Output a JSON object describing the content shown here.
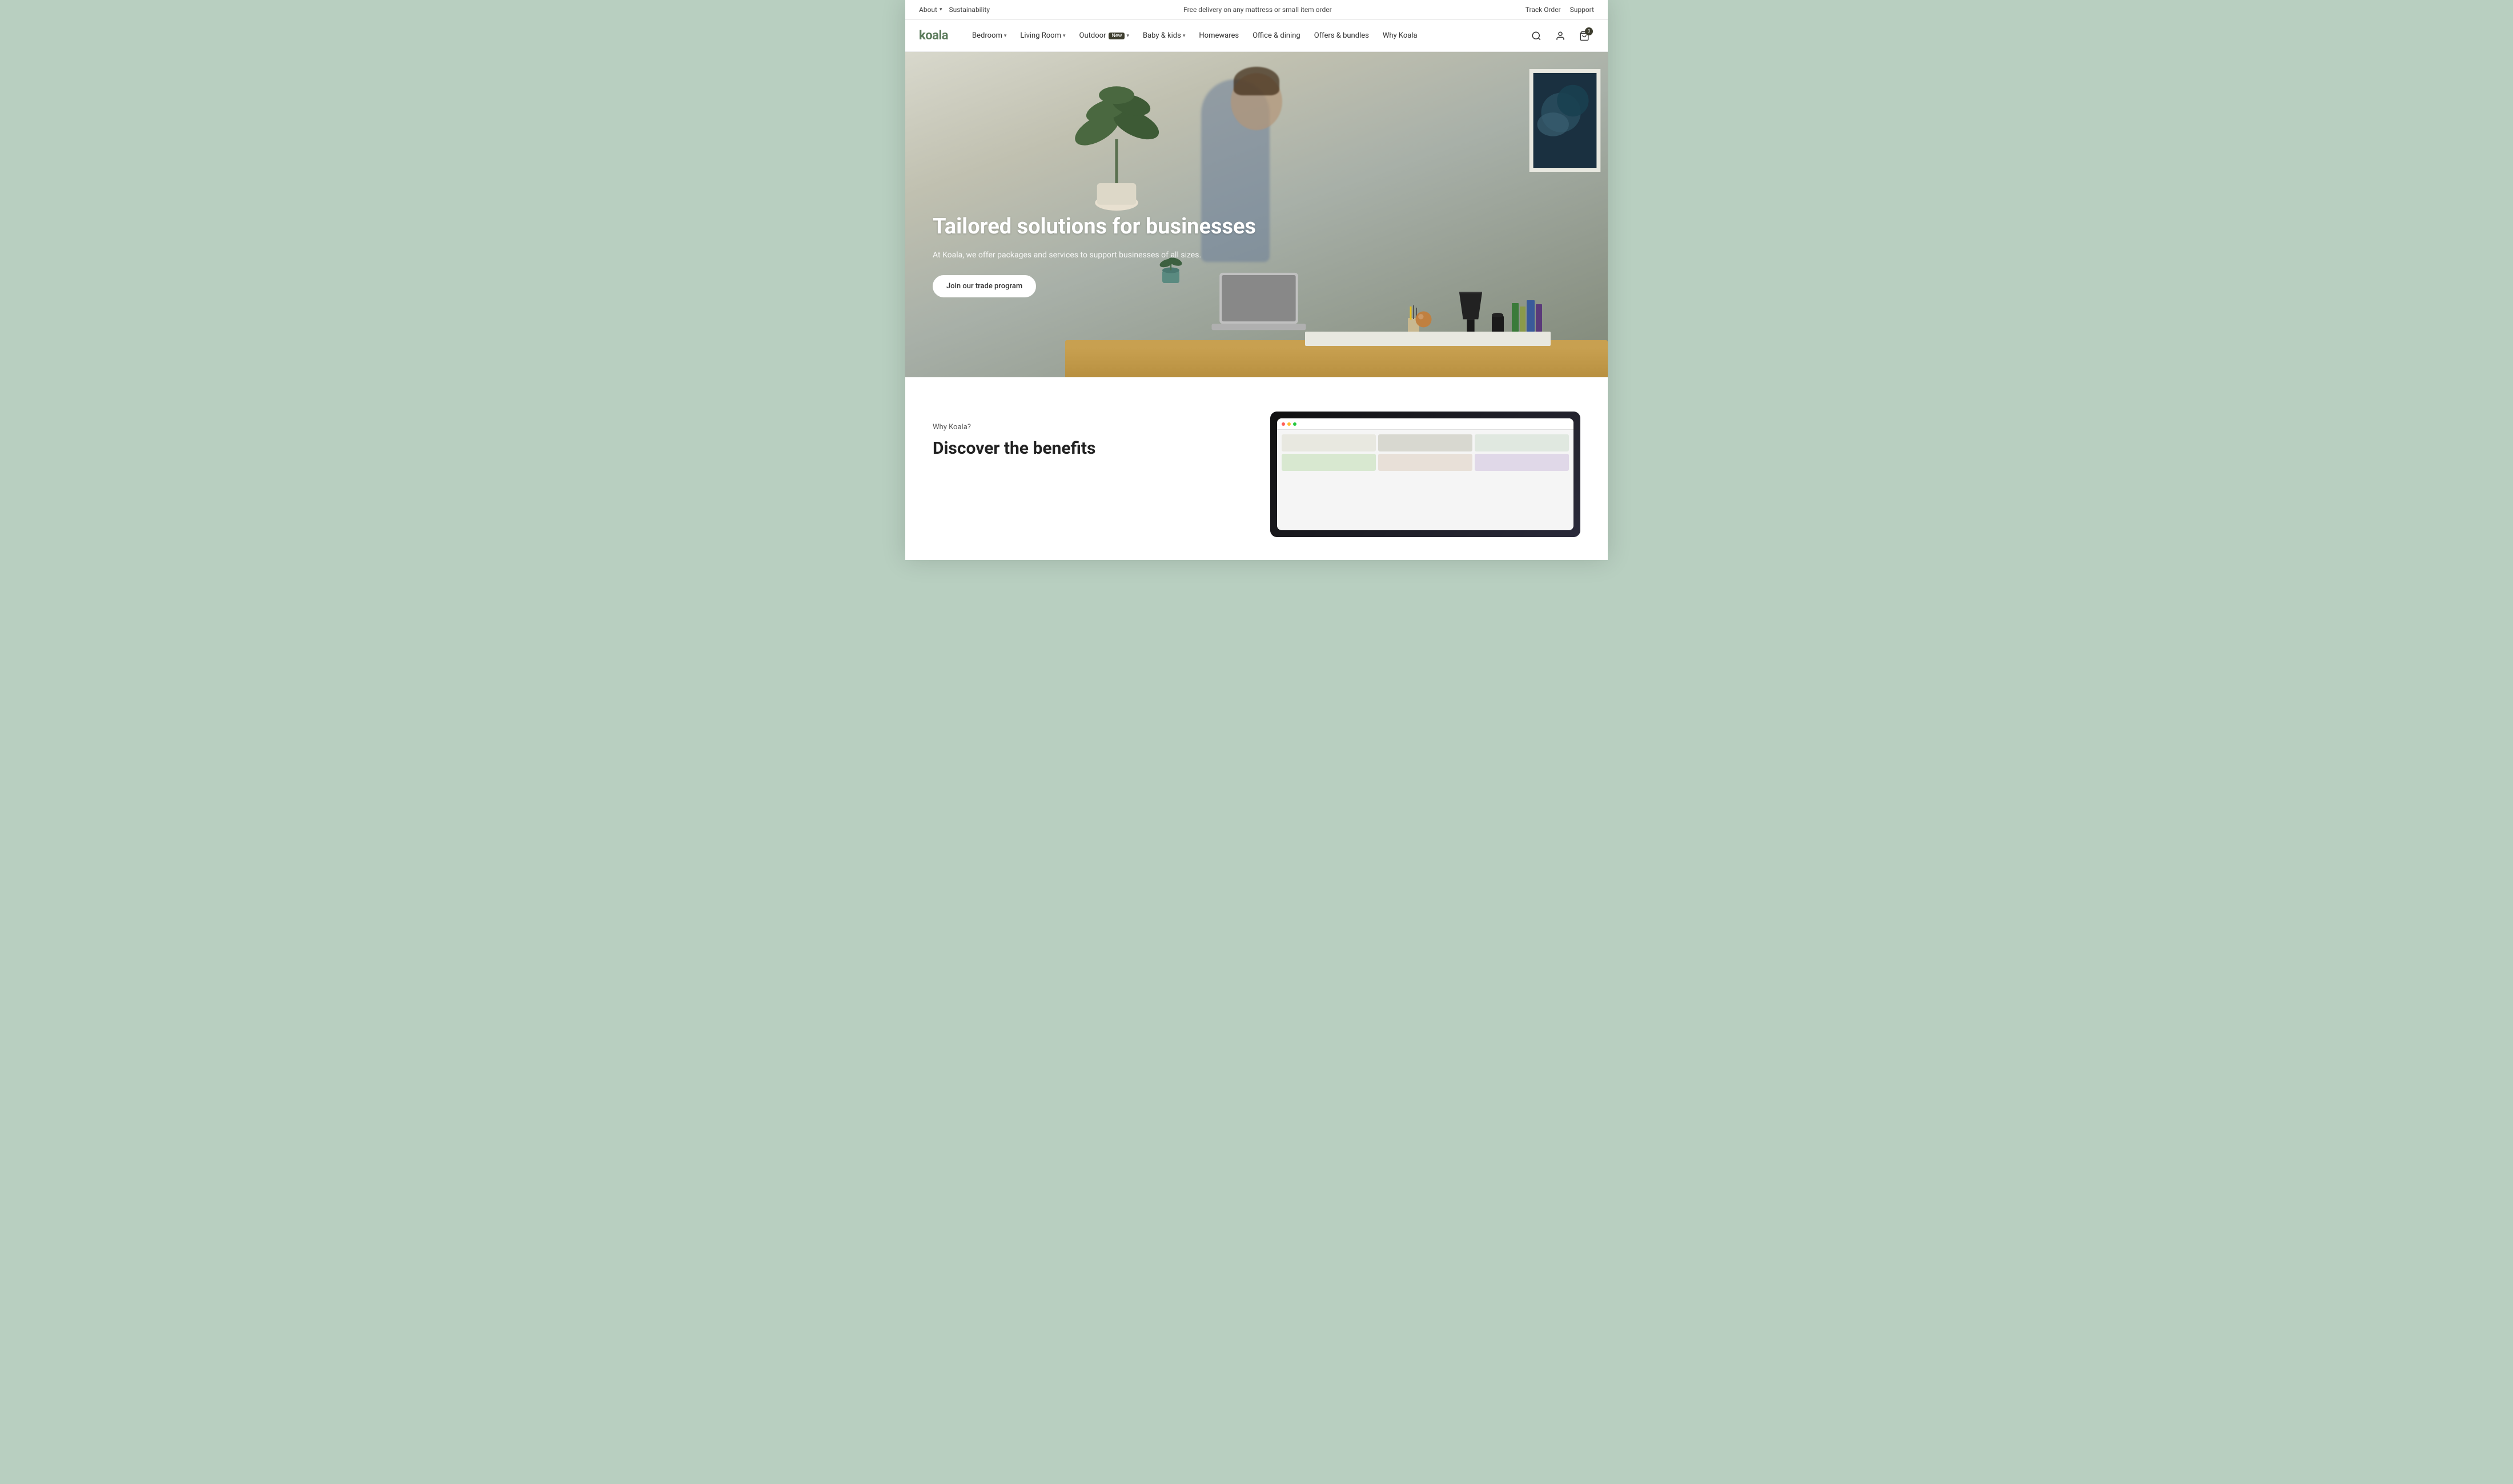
{
  "page": {
    "title": "Koala - Tailored solutions for businesses"
  },
  "topbar": {
    "about_label": "About",
    "sustainability_label": "Sustainability",
    "promo_text": "Free delivery on any mattress or small item order",
    "track_order_label": "Track Order",
    "support_label": "Support"
  },
  "logo": {
    "text": "koala"
  },
  "nav": {
    "items": [
      {
        "label": "Bedroom",
        "has_dropdown": true,
        "badge": null
      },
      {
        "label": "Living Room",
        "has_dropdown": true,
        "badge": null
      },
      {
        "label": "Outdoor",
        "has_dropdown": true,
        "badge": "New"
      },
      {
        "label": "Baby & kids",
        "has_dropdown": true,
        "badge": null
      },
      {
        "label": "Homewares",
        "has_dropdown": false,
        "badge": null
      },
      {
        "label": "Office & dining",
        "has_dropdown": false,
        "badge": null
      },
      {
        "label": "Offers & bundles",
        "has_dropdown": false,
        "badge": null
      },
      {
        "label": "Why Koala",
        "has_dropdown": false,
        "badge": null
      }
    ],
    "cart_count": "0"
  },
  "hero": {
    "title": "Tailored solutions for businesses",
    "subtitle": "At Koala, we offer packages and services to support businesses of all sizes.",
    "cta_label": "Join our trade program"
  },
  "below_hero": {
    "why_label": "Why Koala?",
    "discover_title": "Discover the benefits"
  },
  "office_dining": {
    "label": "Office dining"
  }
}
